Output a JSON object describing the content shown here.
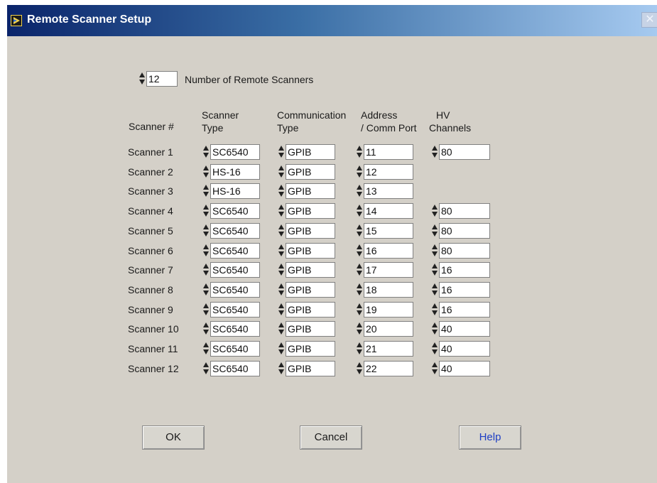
{
  "window": {
    "title": "Remote Scanner Setup",
    "close_glyph": "✕"
  },
  "count": {
    "value": "12",
    "label": "Number of Remote Scanners"
  },
  "headers": {
    "scanner": "Scanner #",
    "type_1": "Scanner",
    "type_2": "Type",
    "comm_1": "Communication",
    "comm_2": "Type",
    "addr_1": "Address",
    "addr_2": "/ Comm Port",
    "hv_1": "HV",
    "hv_2": "Channels"
  },
  "rows": [
    {
      "label": "Scanner 1",
      "type": "SC6540",
      "comm": "GPIB",
      "address": "11",
      "hv": "80"
    },
    {
      "label": "Scanner 2",
      "type": "HS-16",
      "comm": "GPIB",
      "address": "12",
      "hv": null
    },
    {
      "label": "Scanner 3",
      "type": "HS-16",
      "comm": "GPIB",
      "address": "13",
      "hv": null
    },
    {
      "label": "Scanner 4",
      "type": "SC6540",
      "comm": "GPIB",
      "address": "14",
      "hv": "80"
    },
    {
      "label": "Scanner 5",
      "type": "SC6540",
      "comm": "GPIB",
      "address": "15",
      "hv": "80"
    },
    {
      "label": "Scanner 6",
      "type": "SC6540",
      "comm": "GPIB",
      "address": "16",
      "hv": "80"
    },
    {
      "label": "Scanner 7",
      "type": "SC6540",
      "comm": "GPIB",
      "address": "17",
      "hv": "16"
    },
    {
      "label": "Scanner 8",
      "type": "SC6540",
      "comm": "GPIB",
      "address": "18",
      "hv": "16"
    },
    {
      "label": "Scanner 9",
      "type": "SC6540",
      "comm": "GPIB",
      "address": "19",
      "hv": "16"
    },
    {
      "label": "Scanner 10",
      "type": "SC6540",
      "comm": "GPIB",
      "address": "20",
      "hv": "40"
    },
    {
      "label": "Scanner 11",
      "type": "SC6540",
      "comm": "GPIB",
      "address": "21",
      "hv": "40"
    },
    {
      "label": "Scanner 12",
      "type": "SC6540",
      "comm": "GPIB",
      "address": "22",
      "hv": "40"
    }
  ],
  "buttons": {
    "ok": "OK",
    "cancel": "Cancel",
    "help": "Help"
  },
  "colors": {
    "panel": "#d4d0c8",
    "title_bar_start": "#0a246a",
    "title_bar_end": "#a6caf0",
    "help_text": "#1f3fc4"
  },
  "icons": {
    "app": "labview-vi-icon",
    "close": "close-icon",
    "spinner": "spinner-arrows-icon"
  }
}
